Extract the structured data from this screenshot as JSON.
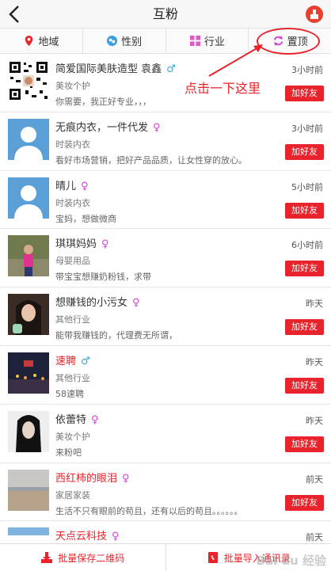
{
  "header": {
    "title": "互粉"
  },
  "tabs": [
    {
      "label": "地域",
      "icon": "location-pin-icon"
    },
    {
      "label": "性别",
      "icon": "gender-icon"
    },
    {
      "label": "行业",
      "icon": "grid-icon"
    },
    {
      "label": "置顶",
      "icon": "refresh-arrows-icon"
    }
  ],
  "callout": {
    "text": "点击一下这里"
  },
  "users": [
    {
      "name": "简爱国际美肤造型 袁鑫",
      "gender": "♂",
      "industry": "美妆个护",
      "intro": "你需要，我正好专业，，，",
      "time": "3小时前",
      "button": "加好友"
    },
    {
      "name": "无痕内衣，一件代发",
      "gender": "♀",
      "industry": "时装内衣",
      "intro": "看好市场营销，把好产品品质，让女性穿的放心。",
      "time": "3小时前",
      "button": "加好友"
    },
    {
      "name": "晴儿",
      "gender": "♀",
      "industry": "时装内衣",
      "intro": "宝妈，想做微商",
      "time": "5小时前",
      "button": "加好友"
    },
    {
      "name": "琪琪妈妈",
      "gender": "♀",
      "industry": "母婴用品",
      "intro": "带宝宝想赚奶粉钱，求带",
      "time": "6小时前",
      "button": "加好友"
    },
    {
      "name": "想赚钱的小污女",
      "gender": "♀",
      "industry": "其他行业",
      "intro": "能带我赚钱的，代理费无所谓，",
      "time": "昨天",
      "button": "加好友"
    },
    {
      "name": "速聘",
      "gender": "♂",
      "industry": "其他行业",
      "intro": "58速聘",
      "time": "昨天",
      "button": "加好友"
    },
    {
      "name": "依蕾特",
      "gender": "♀",
      "industry": "美妆个护",
      "intro": "来粉吧",
      "time": "昨天",
      "button": "加好友"
    },
    {
      "name": "西红柿的眼泪",
      "gender": "♀",
      "industry": "家居家装",
      "intro": "生活不只有眼前的苟且，还有以后的苟且。。。。。。",
      "time": "前天",
      "button": "加好友"
    },
    {
      "name": "天点云科技",
      "gender": "♀",
      "industry": "",
      "intro": "",
      "time": "前天",
      "button": ""
    }
  ],
  "footer": {
    "save_qr": "批量保存二维码",
    "import_contacts": "批量导入通讯录"
  },
  "watermark": "Bai du 经验",
  "colors": {
    "accent": "#e8232b",
    "male": "#35a8d6",
    "female": "#d43fd9"
  }
}
